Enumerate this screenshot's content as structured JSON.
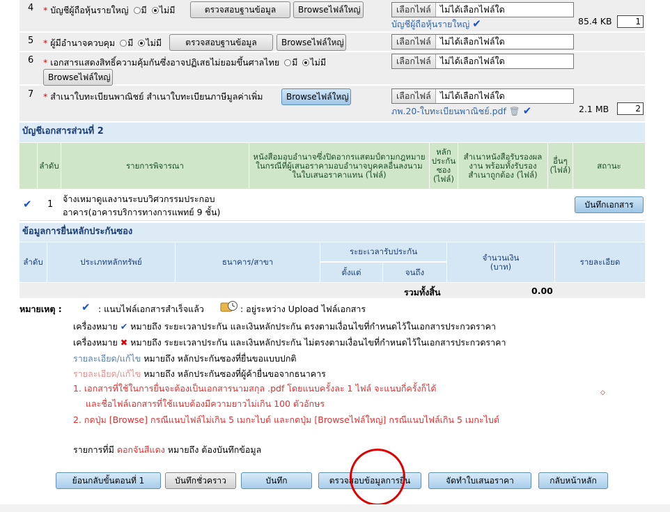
{
  "doc_rows": [
    {
      "no": "4",
      "label": "บัญชีผู้ถือหุ้นรายใหญ่",
      "radio_yes": "มี",
      "radio_no": "ไม่มี",
      "check_btn": "ตรวจสอบฐานข้อมูล",
      "browse_btn": "Browseไฟล์ใหญ่",
      "file_btn": "เลือกไฟล์",
      "file_text": "ไม่ได้เลือกไฟล์ใด",
      "attached": "บัญชีผู้ถือหุ้นรายใหญ่",
      "size": "85.4 KB",
      "count": "1"
    },
    {
      "no": "5",
      "label": "ผู้มีอำนาจควบคุม",
      "radio_yes": "มี",
      "radio_no": "ไม่มี",
      "check_btn": "ตรวจสอบฐานข้อมูล",
      "browse_btn": "Browseไฟล์ใหญ่",
      "file_btn": "เลือกไฟล์",
      "file_text": "ไม่ได้เลือกไฟล์ใด"
    },
    {
      "no": "6",
      "label": "เอกสารแสดงสิทธิ์ความคุ้มกันซึ่งอาจปฏิเสธไม่ยอมขึ้นศาลไทย",
      "radio_yes": "มี",
      "radio_no": "ไม่มี",
      "browse_btn": "Browseไฟล์ใหญ่",
      "file_btn": "เลือกไฟล์",
      "file_text": "ไม่ได้เลือกไฟล์ใด"
    },
    {
      "no": "7",
      "label": "สำเนาใบทะเบียนพาณิชย์ สำเนาใบทะเบียนภาษีมูลค่าเพิ่ม",
      "browse_btn": "Browseไฟล์ใหญ่",
      "file_btn": "เลือกไฟล์",
      "file_text": "ไม่ได้เลือกไฟล์ใด",
      "attached": "ภพ.20-ใบทะเบียนพาณิชย์.pdf",
      "size": "2.1 MB",
      "count": "2"
    }
  ],
  "section2": {
    "title": "บัญชีเอกสารส่วนที่ 2",
    "headers": {
      "order": "ลำดับ",
      "item": "รายการพิจารณา",
      "poa": "หนังสือมอบอำนาจซึ่งปิดอากรแสตมป์ตามกฎหมายในกรณีที่ผู้เสนอราคามอบอำนาจบุคคลอื่นลงนามในใบเสนอราคาแทน (ไฟล์)",
      "guarantee": "หลักประกันซอง (ไฟล์)",
      "copy": "สำเนาหนังสือรับรองผลงาน พร้อมทั้งรับรองสำเนาถูกต้อง (ไฟล์)",
      "other": "อื่นๆ (ไฟล์)",
      "status": "สถานะ"
    },
    "row": {
      "no": "1",
      "item": "จ้างเหมาดูแลงานระบบวิศวกรรมประกอบอาคาร(อาคารบริการทางการแพทย์ 9 ชั้น)",
      "save_btn": "บันทึกเอกสาร"
    }
  },
  "guarantee": {
    "title": "ข้อมูลการยื่นหลักประกันซอง",
    "headers": {
      "order": "ลำดับ",
      "type": "ประเภทหลักทรัพย์",
      "bank": "ธนาคาร/สาขา",
      "period": "ระยะเวลารับประกัน",
      "from": "ตั้งแต่",
      "to": "จนถึง",
      "amount": "จำนวนเงิน (บาท)",
      "detail": "รายละเอียด"
    },
    "total_label": "รวมทั้งสิ้น",
    "total_value": "0.00"
  },
  "notes": {
    "heading": "หมายเหตุ :",
    "attached_ok": ": แนบไฟล์เอกสารสำเร็จแล้ว",
    "uploading": ": อยู่ระหว่าง Upload ไฟล์เอกสาร",
    "mark_prefix": "เครื่องหมาย",
    "mark_ok": "หมายถึง ระยะเวลาประกัน และเงินหลักประกัน ตรงตามเงื่อนไขที่กำหนดไว้ในเอกสารประกวดราคา",
    "mark_bad": "หมายถึง ระยะเวลาประกัน และเงินหลักประกัน ไม่ตรงตามเงื่อนไขที่กำหนดไว้ในเอกสารประกวดราคา",
    "edit_link1": "รายละเอียด/แก้ไข",
    "edit_text1": "หมายถึง หลักประกันซองที่ยื่นขอแบบปกติ",
    "edit_link2": "รายละเอียด/แก้ไข",
    "edit_text2": "หมายถึง หลักประกันซองที่ผู้ค้ายื่นขอจากธนาคาร",
    "rule1a": "1. เอกสารที่ใช้ในการยื่นจะต้องเป็นเอกสารนามสกุล .pdf โดยแนบครั้งละ 1 ไฟล์ จะแนบกี่ครั้งก็ได้",
    "rule1b": "และชื่อไฟล์เอกสารที่ใช้แนบต้องมีความยาวไม่เกิน 100 ตัวอักษร",
    "rule2": "2. กดปุ่ม [Browse] กรณีแนบไฟล์ไม่เกิน 5 เมกะไบต์ และกดปุ่ม [Browseไฟล์ใหญ่] กรณีแนบไฟล์เกิน  5 เมกะไบต์",
    "req_prefix": "รายการที่มี",
    "req_red": "ดอกจันสีแดง",
    "req_suffix": "หมายถึง ต้องบันทึกข้อมูล"
  },
  "buttons": {
    "back": "ย้อนกลับขั้นตอนที่ 1",
    "draft": "บันทึกชั่วคราว",
    "save": "บันทึก",
    "verify": "ตรวจสอบข้อมูลการยื่น",
    "make": "จัดทำใบเสนอราคา",
    "home": "กลับหน้าหลัก"
  },
  "colors": {
    "section_bg": "#dcebf6",
    "header_green": "#cfe6c9",
    "annotation_red": "#e00000",
    "check_blue": "#1a4fd6"
  }
}
